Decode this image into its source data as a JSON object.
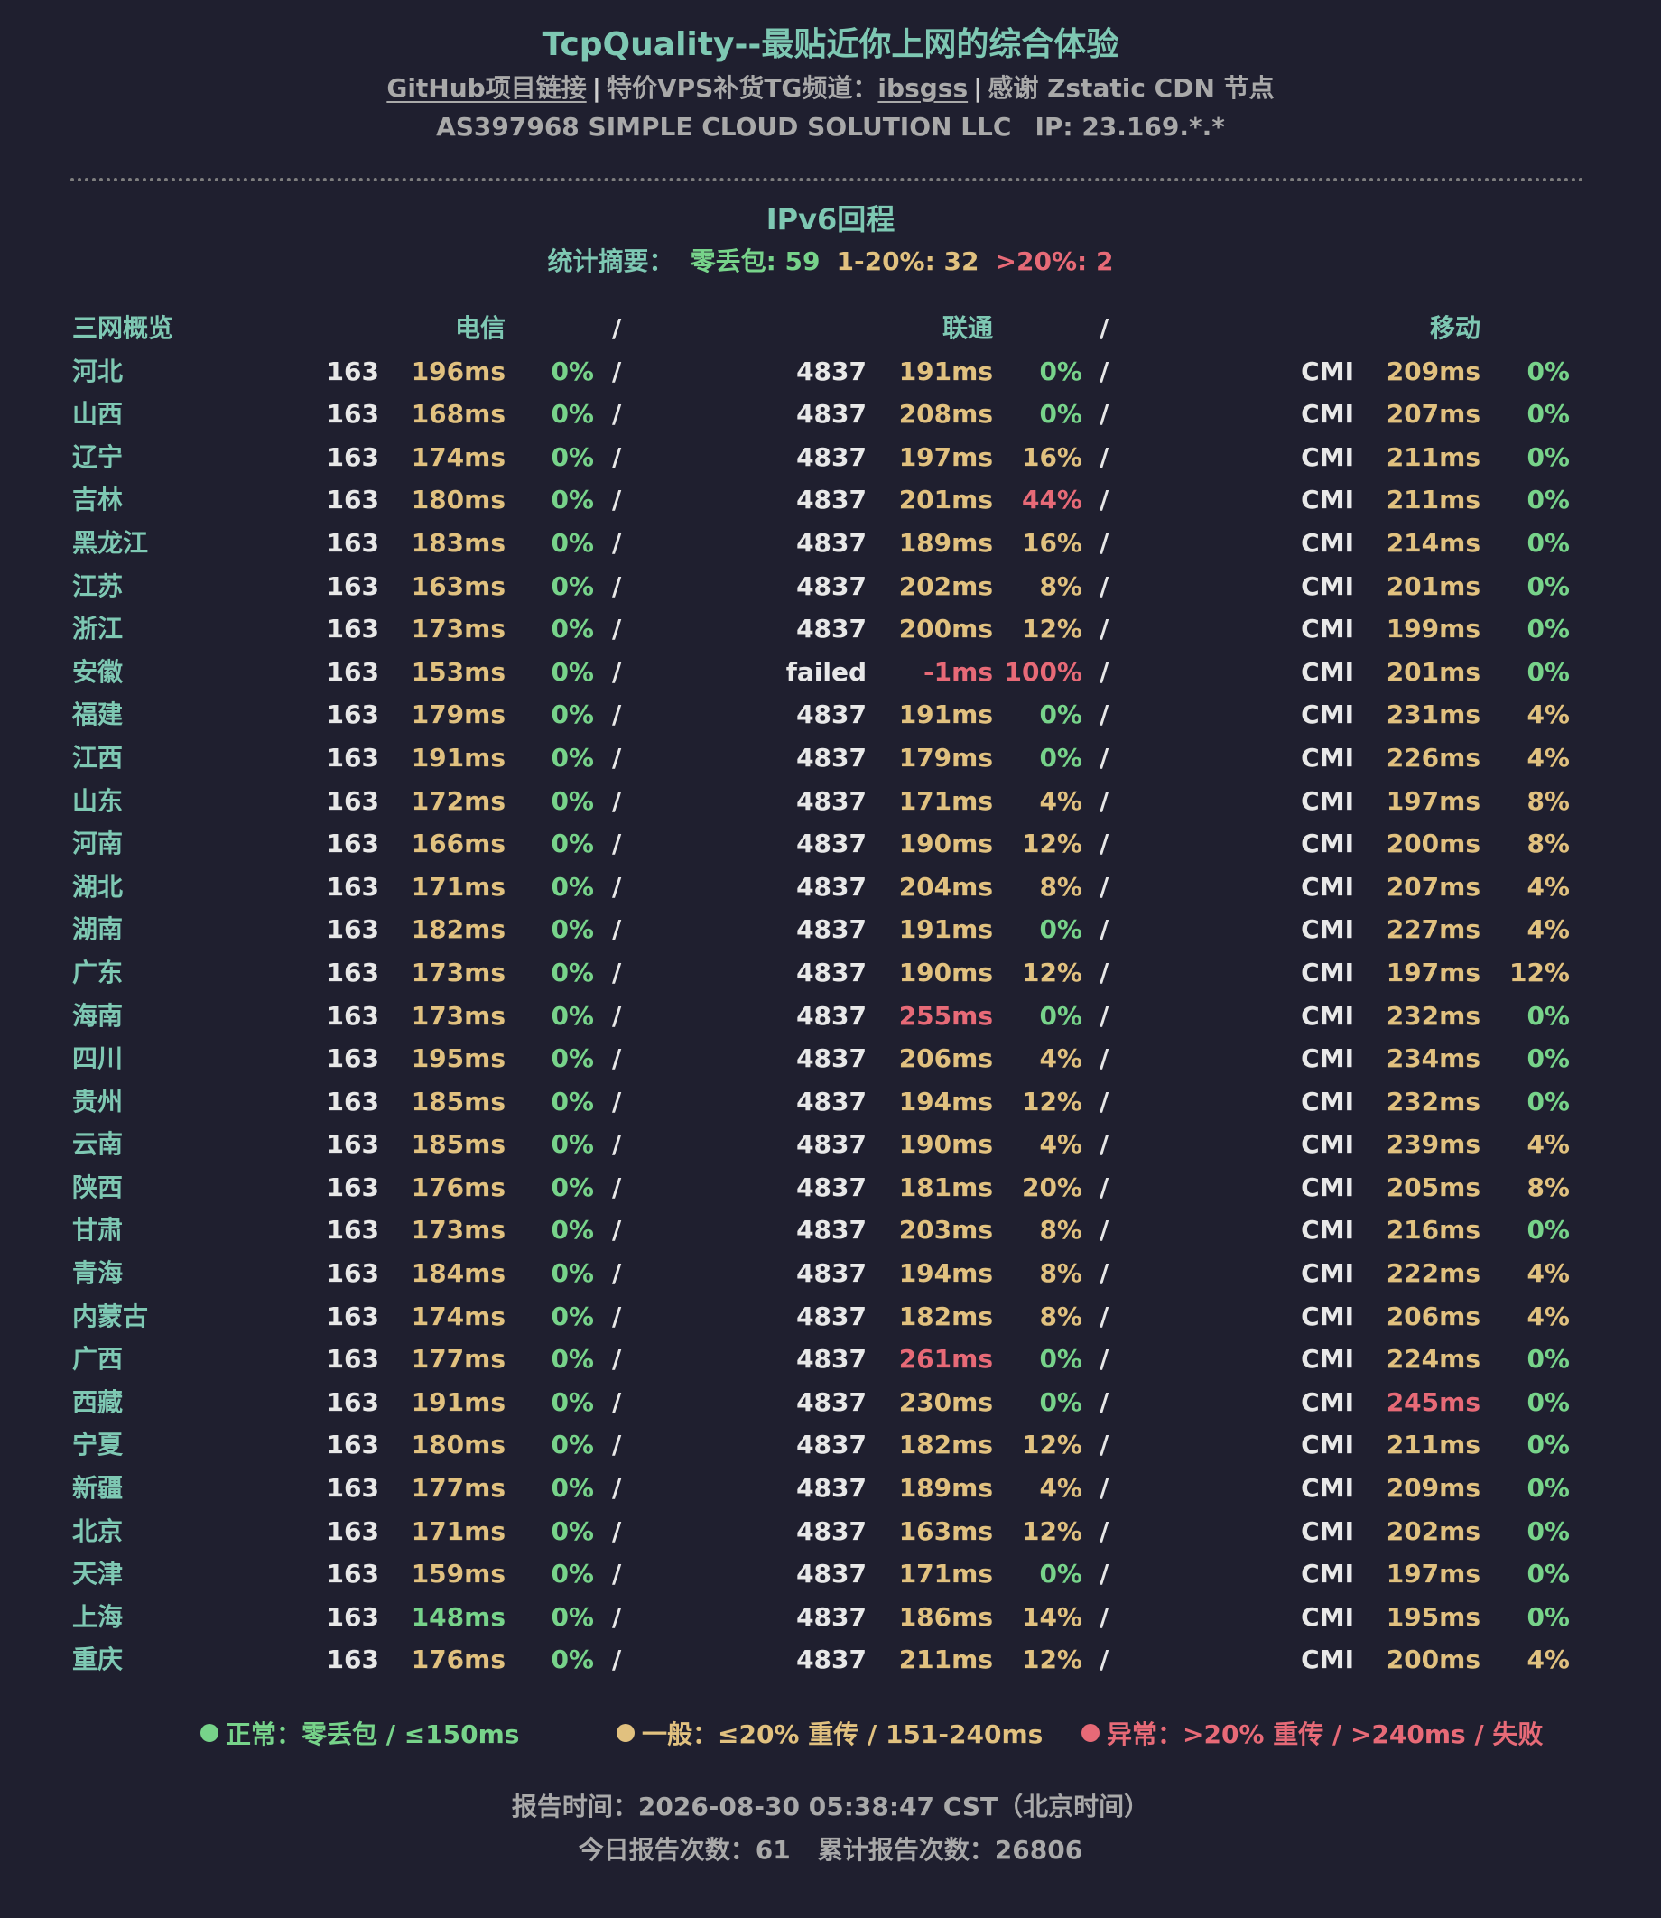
{
  "header": {
    "title": "TcpQuality--最贴近你上网的综合体验",
    "github_link": "GitHub项目链接",
    "separator": "|",
    "vps_label": "特价VPS补货TG频道：",
    "vps_link": "ibsgss",
    "thanks": "感谢 Zstatic CDN 节点",
    "as_info": "AS397968 SIMPLE CLOUD SOLUTION LLC",
    "ip_info": "IP: 23.169.*.*"
  },
  "section_title": "IPv6回程",
  "summary": {
    "label": "统计摘要：",
    "zero_loss": "零丢包: 59",
    "mid_loss": "1-20%: 32",
    "high_loss": ">20%: 2"
  },
  "table_header": {
    "overview": "三网概览",
    "telecom": "电信",
    "unicom": "联通",
    "mobile": "移动",
    "slash": "/"
  },
  "colors": {
    "green": "#77d38a",
    "yellow": "#e1c17f",
    "red": "#e76a77",
    "teal": "#7ec8b3",
    "gray": "#a9a9a9",
    "background": "#1f1f2f"
  },
  "rows": [
    {
      "province": "河北",
      "ct": {
        "asn": "163",
        "lat": "196ms",
        "lat_s": "yellow",
        "loss": "0%",
        "loss_s": "green"
      },
      "cu": {
        "asn": "4837",
        "lat": "191ms",
        "lat_s": "yellow",
        "loss": "0%",
        "loss_s": "green"
      },
      "cm": {
        "asn": "CMI",
        "lat": "209ms",
        "lat_s": "yellow",
        "loss": "0%",
        "loss_s": "green"
      }
    },
    {
      "province": "山西",
      "ct": {
        "asn": "163",
        "lat": "168ms",
        "lat_s": "yellow",
        "loss": "0%",
        "loss_s": "green"
      },
      "cu": {
        "asn": "4837",
        "lat": "208ms",
        "lat_s": "yellow",
        "loss": "0%",
        "loss_s": "green"
      },
      "cm": {
        "asn": "CMI",
        "lat": "207ms",
        "lat_s": "yellow",
        "loss": "0%",
        "loss_s": "green"
      }
    },
    {
      "province": "辽宁",
      "ct": {
        "asn": "163",
        "lat": "174ms",
        "lat_s": "yellow",
        "loss": "0%",
        "loss_s": "green"
      },
      "cu": {
        "asn": "4837",
        "lat": "197ms",
        "lat_s": "yellow",
        "loss": "16%",
        "loss_s": "yellow"
      },
      "cm": {
        "asn": "CMI",
        "lat": "211ms",
        "lat_s": "yellow",
        "loss": "0%",
        "loss_s": "green"
      }
    },
    {
      "province": "吉林",
      "ct": {
        "asn": "163",
        "lat": "180ms",
        "lat_s": "yellow",
        "loss": "0%",
        "loss_s": "green"
      },
      "cu": {
        "asn": "4837",
        "lat": "201ms",
        "lat_s": "yellow",
        "loss": "44%",
        "loss_s": "red"
      },
      "cm": {
        "asn": "CMI",
        "lat": "211ms",
        "lat_s": "yellow",
        "loss": "0%",
        "loss_s": "green"
      }
    },
    {
      "province": "黑龙江",
      "ct": {
        "asn": "163",
        "lat": "183ms",
        "lat_s": "yellow",
        "loss": "0%",
        "loss_s": "green"
      },
      "cu": {
        "asn": "4837",
        "lat": "189ms",
        "lat_s": "yellow",
        "loss": "16%",
        "loss_s": "yellow"
      },
      "cm": {
        "asn": "CMI",
        "lat": "214ms",
        "lat_s": "yellow",
        "loss": "0%",
        "loss_s": "green"
      }
    },
    {
      "province": "江苏",
      "ct": {
        "asn": "163",
        "lat": "163ms",
        "lat_s": "yellow",
        "loss": "0%",
        "loss_s": "green"
      },
      "cu": {
        "asn": "4837",
        "lat": "202ms",
        "lat_s": "yellow",
        "loss": "8%",
        "loss_s": "yellow"
      },
      "cm": {
        "asn": "CMI",
        "lat": "201ms",
        "lat_s": "yellow",
        "loss": "0%",
        "loss_s": "green"
      }
    },
    {
      "province": "浙江",
      "ct": {
        "asn": "163",
        "lat": "173ms",
        "lat_s": "yellow",
        "loss": "0%",
        "loss_s": "green"
      },
      "cu": {
        "asn": "4837",
        "lat": "200ms",
        "lat_s": "yellow",
        "loss": "12%",
        "loss_s": "yellow"
      },
      "cm": {
        "asn": "CMI",
        "lat": "199ms",
        "lat_s": "yellow",
        "loss": "0%",
        "loss_s": "green"
      }
    },
    {
      "province": "安徽",
      "ct": {
        "asn": "163",
        "lat": "153ms",
        "lat_s": "yellow",
        "loss": "0%",
        "loss_s": "green"
      },
      "cu": {
        "asn": "failed",
        "lat": "-1ms",
        "lat_s": "red",
        "loss": "100%",
        "loss_s": "red"
      },
      "cm": {
        "asn": "CMI",
        "lat": "201ms",
        "lat_s": "yellow",
        "loss": "0%",
        "loss_s": "green"
      }
    },
    {
      "province": "福建",
      "ct": {
        "asn": "163",
        "lat": "179ms",
        "lat_s": "yellow",
        "loss": "0%",
        "loss_s": "green"
      },
      "cu": {
        "asn": "4837",
        "lat": "191ms",
        "lat_s": "yellow",
        "loss": "0%",
        "loss_s": "green"
      },
      "cm": {
        "asn": "CMI",
        "lat": "231ms",
        "lat_s": "yellow",
        "loss": "4%",
        "loss_s": "yellow"
      }
    },
    {
      "province": "江西",
      "ct": {
        "asn": "163",
        "lat": "191ms",
        "lat_s": "yellow",
        "loss": "0%",
        "loss_s": "green"
      },
      "cu": {
        "asn": "4837",
        "lat": "179ms",
        "lat_s": "yellow",
        "loss": "0%",
        "loss_s": "green"
      },
      "cm": {
        "asn": "CMI",
        "lat": "226ms",
        "lat_s": "yellow",
        "loss": "4%",
        "loss_s": "yellow"
      }
    },
    {
      "province": "山东",
      "ct": {
        "asn": "163",
        "lat": "172ms",
        "lat_s": "yellow",
        "loss": "0%",
        "loss_s": "green"
      },
      "cu": {
        "asn": "4837",
        "lat": "171ms",
        "lat_s": "yellow",
        "loss": "4%",
        "loss_s": "yellow"
      },
      "cm": {
        "asn": "CMI",
        "lat": "197ms",
        "lat_s": "yellow",
        "loss": "8%",
        "loss_s": "yellow"
      }
    },
    {
      "province": "河南",
      "ct": {
        "asn": "163",
        "lat": "166ms",
        "lat_s": "yellow",
        "loss": "0%",
        "loss_s": "green"
      },
      "cu": {
        "asn": "4837",
        "lat": "190ms",
        "lat_s": "yellow",
        "loss": "12%",
        "loss_s": "yellow"
      },
      "cm": {
        "asn": "CMI",
        "lat": "200ms",
        "lat_s": "yellow",
        "loss": "8%",
        "loss_s": "yellow"
      }
    },
    {
      "province": "湖北",
      "ct": {
        "asn": "163",
        "lat": "171ms",
        "lat_s": "yellow",
        "loss": "0%",
        "loss_s": "green"
      },
      "cu": {
        "asn": "4837",
        "lat": "204ms",
        "lat_s": "yellow",
        "loss": "8%",
        "loss_s": "yellow"
      },
      "cm": {
        "asn": "CMI",
        "lat": "207ms",
        "lat_s": "yellow",
        "loss": "4%",
        "loss_s": "yellow"
      }
    },
    {
      "province": "湖南",
      "ct": {
        "asn": "163",
        "lat": "182ms",
        "lat_s": "yellow",
        "loss": "0%",
        "loss_s": "green"
      },
      "cu": {
        "asn": "4837",
        "lat": "191ms",
        "lat_s": "yellow",
        "loss": "0%",
        "loss_s": "green"
      },
      "cm": {
        "asn": "CMI",
        "lat": "227ms",
        "lat_s": "yellow",
        "loss": "4%",
        "loss_s": "yellow"
      }
    },
    {
      "province": "广东",
      "ct": {
        "asn": "163",
        "lat": "173ms",
        "lat_s": "yellow",
        "loss": "0%",
        "loss_s": "green"
      },
      "cu": {
        "asn": "4837",
        "lat": "190ms",
        "lat_s": "yellow",
        "loss": "12%",
        "loss_s": "yellow"
      },
      "cm": {
        "asn": "CMI",
        "lat": "197ms",
        "lat_s": "yellow",
        "loss": "12%",
        "loss_s": "yellow"
      }
    },
    {
      "province": "海南",
      "ct": {
        "asn": "163",
        "lat": "173ms",
        "lat_s": "yellow",
        "loss": "0%",
        "loss_s": "green"
      },
      "cu": {
        "asn": "4837",
        "lat": "255ms",
        "lat_s": "red",
        "loss": "0%",
        "loss_s": "green"
      },
      "cm": {
        "asn": "CMI",
        "lat": "232ms",
        "lat_s": "yellow",
        "loss": "0%",
        "loss_s": "green"
      }
    },
    {
      "province": "四川",
      "ct": {
        "asn": "163",
        "lat": "195ms",
        "lat_s": "yellow",
        "loss": "0%",
        "loss_s": "green"
      },
      "cu": {
        "asn": "4837",
        "lat": "206ms",
        "lat_s": "yellow",
        "loss": "4%",
        "loss_s": "yellow"
      },
      "cm": {
        "asn": "CMI",
        "lat": "234ms",
        "lat_s": "yellow",
        "loss": "0%",
        "loss_s": "green"
      }
    },
    {
      "province": "贵州",
      "ct": {
        "asn": "163",
        "lat": "185ms",
        "lat_s": "yellow",
        "loss": "0%",
        "loss_s": "green"
      },
      "cu": {
        "asn": "4837",
        "lat": "194ms",
        "lat_s": "yellow",
        "loss": "12%",
        "loss_s": "yellow"
      },
      "cm": {
        "asn": "CMI",
        "lat": "232ms",
        "lat_s": "yellow",
        "loss": "0%",
        "loss_s": "green"
      }
    },
    {
      "province": "云南",
      "ct": {
        "asn": "163",
        "lat": "185ms",
        "lat_s": "yellow",
        "loss": "0%",
        "loss_s": "green"
      },
      "cu": {
        "asn": "4837",
        "lat": "190ms",
        "lat_s": "yellow",
        "loss": "4%",
        "loss_s": "yellow"
      },
      "cm": {
        "asn": "CMI",
        "lat": "239ms",
        "lat_s": "yellow",
        "loss": "4%",
        "loss_s": "yellow"
      }
    },
    {
      "province": "陕西",
      "ct": {
        "asn": "163",
        "lat": "176ms",
        "lat_s": "yellow",
        "loss": "0%",
        "loss_s": "green"
      },
      "cu": {
        "asn": "4837",
        "lat": "181ms",
        "lat_s": "yellow",
        "loss": "20%",
        "loss_s": "yellow"
      },
      "cm": {
        "asn": "CMI",
        "lat": "205ms",
        "lat_s": "yellow",
        "loss": "8%",
        "loss_s": "yellow"
      }
    },
    {
      "province": "甘肃",
      "ct": {
        "asn": "163",
        "lat": "173ms",
        "lat_s": "yellow",
        "loss": "0%",
        "loss_s": "green"
      },
      "cu": {
        "asn": "4837",
        "lat": "203ms",
        "lat_s": "yellow",
        "loss": "8%",
        "loss_s": "yellow"
      },
      "cm": {
        "asn": "CMI",
        "lat": "216ms",
        "lat_s": "yellow",
        "loss": "0%",
        "loss_s": "green"
      }
    },
    {
      "province": "青海",
      "ct": {
        "asn": "163",
        "lat": "184ms",
        "lat_s": "yellow",
        "loss": "0%",
        "loss_s": "green"
      },
      "cu": {
        "asn": "4837",
        "lat": "194ms",
        "lat_s": "yellow",
        "loss": "8%",
        "loss_s": "yellow"
      },
      "cm": {
        "asn": "CMI",
        "lat": "222ms",
        "lat_s": "yellow",
        "loss": "4%",
        "loss_s": "yellow"
      }
    },
    {
      "province": "内蒙古",
      "ct": {
        "asn": "163",
        "lat": "174ms",
        "lat_s": "yellow",
        "loss": "0%",
        "loss_s": "green"
      },
      "cu": {
        "asn": "4837",
        "lat": "182ms",
        "lat_s": "yellow",
        "loss": "8%",
        "loss_s": "yellow"
      },
      "cm": {
        "asn": "CMI",
        "lat": "206ms",
        "lat_s": "yellow",
        "loss": "4%",
        "loss_s": "yellow"
      }
    },
    {
      "province": "广西",
      "ct": {
        "asn": "163",
        "lat": "177ms",
        "lat_s": "yellow",
        "loss": "0%",
        "loss_s": "green"
      },
      "cu": {
        "asn": "4837",
        "lat": "261ms",
        "lat_s": "red",
        "loss": "0%",
        "loss_s": "green"
      },
      "cm": {
        "asn": "CMI",
        "lat": "224ms",
        "lat_s": "yellow",
        "loss": "0%",
        "loss_s": "green"
      }
    },
    {
      "province": "西藏",
      "ct": {
        "asn": "163",
        "lat": "191ms",
        "lat_s": "yellow",
        "loss": "0%",
        "loss_s": "green"
      },
      "cu": {
        "asn": "4837",
        "lat": "230ms",
        "lat_s": "yellow",
        "loss": "0%",
        "loss_s": "green"
      },
      "cm": {
        "asn": "CMI",
        "lat": "245ms",
        "lat_s": "red",
        "loss": "0%",
        "loss_s": "green"
      }
    },
    {
      "province": "宁夏",
      "ct": {
        "asn": "163",
        "lat": "180ms",
        "lat_s": "yellow",
        "loss": "0%",
        "loss_s": "green"
      },
      "cu": {
        "asn": "4837",
        "lat": "182ms",
        "lat_s": "yellow",
        "loss": "12%",
        "loss_s": "yellow"
      },
      "cm": {
        "asn": "CMI",
        "lat": "211ms",
        "lat_s": "yellow",
        "loss": "0%",
        "loss_s": "green"
      }
    },
    {
      "province": "新疆",
      "ct": {
        "asn": "163",
        "lat": "177ms",
        "lat_s": "yellow",
        "loss": "0%",
        "loss_s": "green"
      },
      "cu": {
        "asn": "4837",
        "lat": "189ms",
        "lat_s": "yellow",
        "loss": "4%",
        "loss_s": "yellow"
      },
      "cm": {
        "asn": "CMI",
        "lat": "209ms",
        "lat_s": "yellow",
        "loss": "0%",
        "loss_s": "green"
      }
    },
    {
      "province": "北京",
      "ct": {
        "asn": "163",
        "lat": "171ms",
        "lat_s": "yellow",
        "loss": "0%",
        "loss_s": "green"
      },
      "cu": {
        "asn": "4837",
        "lat": "163ms",
        "lat_s": "yellow",
        "loss": "12%",
        "loss_s": "yellow"
      },
      "cm": {
        "asn": "CMI",
        "lat": "202ms",
        "lat_s": "yellow",
        "loss": "0%",
        "loss_s": "green"
      }
    },
    {
      "province": "天津",
      "ct": {
        "asn": "163",
        "lat": "159ms",
        "lat_s": "yellow",
        "loss": "0%",
        "loss_s": "green"
      },
      "cu": {
        "asn": "4837",
        "lat": "171ms",
        "lat_s": "yellow",
        "loss": "0%",
        "loss_s": "green"
      },
      "cm": {
        "asn": "CMI",
        "lat": "197ms",
        "lat_s": "yellow",
        "loss": "0%",
        "loss_s": "green"
      }
    },
    {
      "province": "上海",
      "ct": {
        "asn": "163",
        "lat": "148ms",
        "lat_s": "green",
        "loss": "0%",
        "loss_s": "green"
      },
      "cu": {
        "asn": "4837",
        "lat": "186ms",
        "lat_s": "yellow",
        "loss": "14%",
        "loss_s": "yellow"
      },
      "cm": {
        "asn": "CMI",
        "lat": "195ms",
        "lat_s": "yellow",
        "loss": "0%",
        "loss_s": "green"
      }
    },
    {
      "province": "重庆",
      "ct": {
        "asn": "163",
        "lat": "176ms",
        "lat_s": "yellow",
        "loss": "0%",
        "loss_s": "green"
      },
      "cu": {
        "asn": "4837",
        "lat": "211ms",
        "lat_s": "yellow",
        "loss": "12%",
        "loss_s": "yellow"
      },
      "cm": {
        "asn": "CMI",
        "lat": "200ms",
        "lat_s": "yellow",
        "loss": "4%",
        "loss_s": "yellow"
      }
    }
  ],
  "legend": {
    "normal": "正常：零丢包 / ≤150ms",
    "average": "一般：≤20% 重传 / 151-240ms",
    "abnormal": "异常：>20% 重传 / >240ms / 失败"
  },
  "footer": {
    "report_time": "报告时间：2026-08-30 05:38:47 CST（北京时间）",
    "today_count": "今日报告次数：61",
    "total_count": "累计报告次数：26806"
  }
}
